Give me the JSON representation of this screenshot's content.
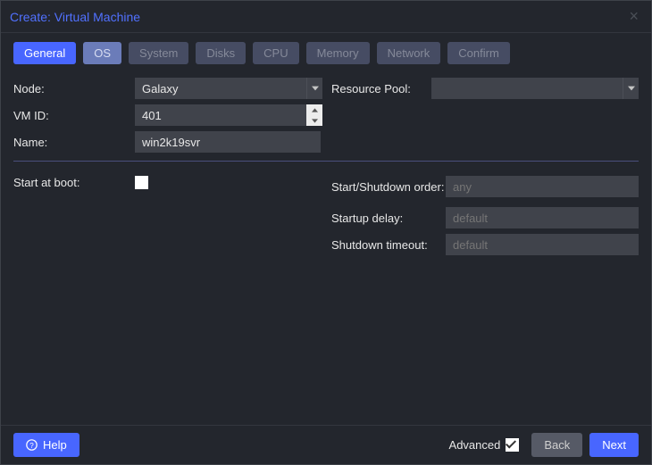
{
  "title": "Create: Virtual Machine",
  "tabs": {
    "general": "General",
    "os": "OS",
    "system": "System",
    "disks": "Disks",
    "cpu": "CPU",
    "memory": "Memory",
    "network": "Network",
    "confirm": "Confirm"
  },
  "labels": {
    "node": "Node:",
    "vmid": "VM ID:",
    "name": "Name:",
    "respool": "Resource Pool:",
    "startboot": "Start at boot:",
    "order": "Start/Shutdown order:",
    "startdelay": "Startup delay:",
    "shuttimeout": "Shutdown timeout:",
    "advanced": "Advanced"
  },
  "values": {
    "node": "Galaxy",
    "vmid": "401",
    "name": "win2k19svr",
    "respool": "",
    "startboot_checked": false,
    "advanced_checked": true
  },
  "placeholders": {
    "order": "any",
    "startdelay": "default",
    "shuttimeout": "default"
  },
  "buttons": {
    "help": "Help",
    "back": "Back",
    "next": "Next"
  }
}
